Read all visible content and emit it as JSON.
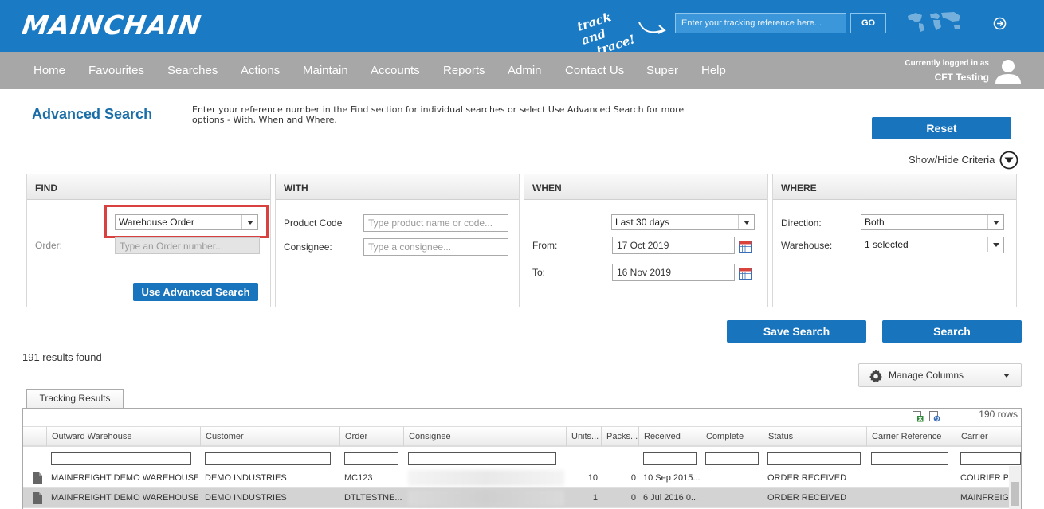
{
  "header": {
    "logo": "MAINCHAIN",
    "track_text_line1": "track and",
    "track_text_line2": "trace!",
    "track_placeholder": "Enter your tracking reference here...",
    "go_label": "GO"
  },
  "nav": {
    "items": [
      "Home",
      "Favourites",
      "Searches",
      "Actions",
      "Maintain",
      "Accounts",
      "Reports",
      "Admin",
      "Contact Us",
      "Super",
      "Help"
    ],
    "login_label": "Currently logged in as",
    "login_user": "CFT Testing"
  },
  "page": {
    "title": "Advanced Search",
    "intro": "Enter your reference number in the Find section for individual searches or select Use Advanced Search for more options - With, When and Where.",
    "reset_label": "Reset",
    "show_hide_label": "Show/Hide Criteria"
  },
  "find": {
    "heading": "FIND",
    "type_value": "Warehouse Order",
    "order_label": "Order:",
    "order_placeholder": "Type an Order number...",
    "advanced_button": "Use Advanced Search"
  },
  "with": {
    "heading": "WITH",
    "product_label": "Product Code",
    "product_placeholder": "Type product name or code...",
    "consignee_label": "Consignee:",
    "consignee_placeholder": "Type a consignee..."
  },
  "when": {
    "heading": "WHEN",
    "range_value": "Last 30 days",
    "from_label": "From:",
    "from_value": "17 Oct 2019",
    "to_label": "To:",
    "to_value": "16 Nov 2019"
  },
  "where": {
    "heading": "WHERE",
    "direction_label": "Direction:",
    "direction_value": "Both",
    "warehouse_label": "Warehouse:",
    "warehouse_value": "1 selected"
  },
  "actions": {
    "save_search": "Save Search",
    "search": "Search"
  },
  "results": {
    "count_text": "191 results found",
    "manage_columns": "Manage Columns",
    "tab_label": "Tracking Results",
    "rows_text": "190 rows",
    "columns": [
      "Outward Warehouse",
      "Customer",
      "Order",
      "Consignee",
      "Units...",
      "Packs...",
      "Received",
      "Complete",
      "Status",
      "Carrier Reference",
      "Carrier"
    ],
    "rows": [
      {
        "warehouse": "MAINFREIGHT DEMO WAREHOUSE",
        "customer": "DEMO INDUSTRIES",
        "order": "MC123",
        "consignee": "",
        "units": "10",
        "packs": "0",
        "received": "10 Sep 2015...",
        "complete": "",
        "status": "ORDER RECEIVED",
        "carrier_ref": "",
        "carrier": "COURIER PC..."
      },
      {
        "warehouse": "MAINFREIGHT DEMO WAREHOUSE",
        "customer": "DEMO INDUSTRIES",
        "order": "DTLTESTNE...",
        "consignee": "",
        "units": "1",
        "packs": "0",
        "received": "6 Jul 2016 0...",
        "complete": "",
        "status": "ORDER RECEIVED",
        "carrier_ref": "",
        "carrier": "MAINFREIGHT..."
      }
    ]
  }
}
